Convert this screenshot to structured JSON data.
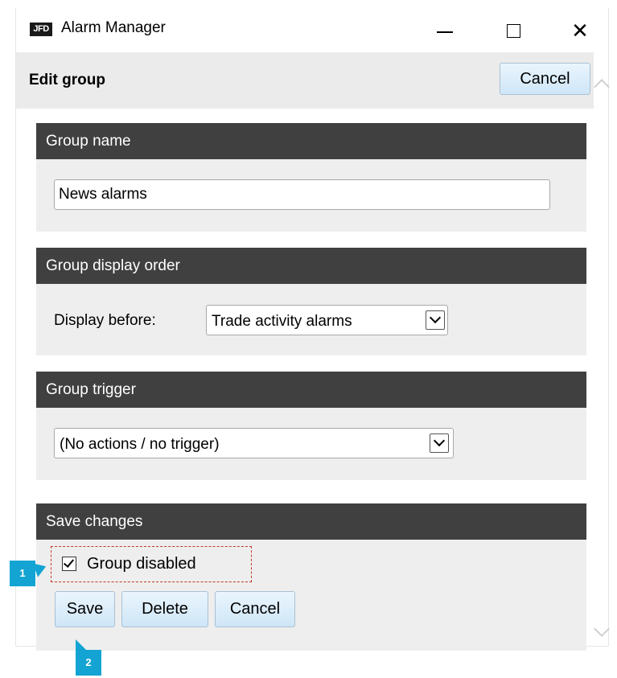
{
  "window": {
    "logo_text": "JFD",
    "title": "Alarm Manager",
    "close_glyph": "✕"
  },
  "header": {
    "title": "Edit group",
    "cancel_label": "Cancel"
  },
  "sections": {
    "group_name": {
      "heading": "Group name",
      "value": "News alarms"
    },
    "display_order": {
      "heading": "Group display order",
      "label": "Display before:",
      "selected": "Trade activity alarms"
    },
    "trigger": {
      "heading": "Group trigger",
      "selected": "(No actions / no trigger)"
    },
    "save": {
      "heading": "Save changes",
      "disabled_label": "Group disabled",
      "disabled_checked": true,
      "save_label": "Save",
      "delete_label": "Delete",
      "cancel_label": "Cancel"
    }
  },
  "annotations": {
    "marker_1": "1",
    "marker_2": "2"
  },
  "colors": {
    "panel_header": "#404040",
    "accent_marker": "#13a4d3",
    "button_fill": "#cfe6f7",
    "highlight_dash": "#c0392b"
  },
  "icons": {
    "minimize": "minimize-icon",
    "maximize": "maximize-icon",
    "close": "close-icon",
    "dropdown": "chevron-down-icon",
    "checkbox": "checkmark-icon"
  }
}
